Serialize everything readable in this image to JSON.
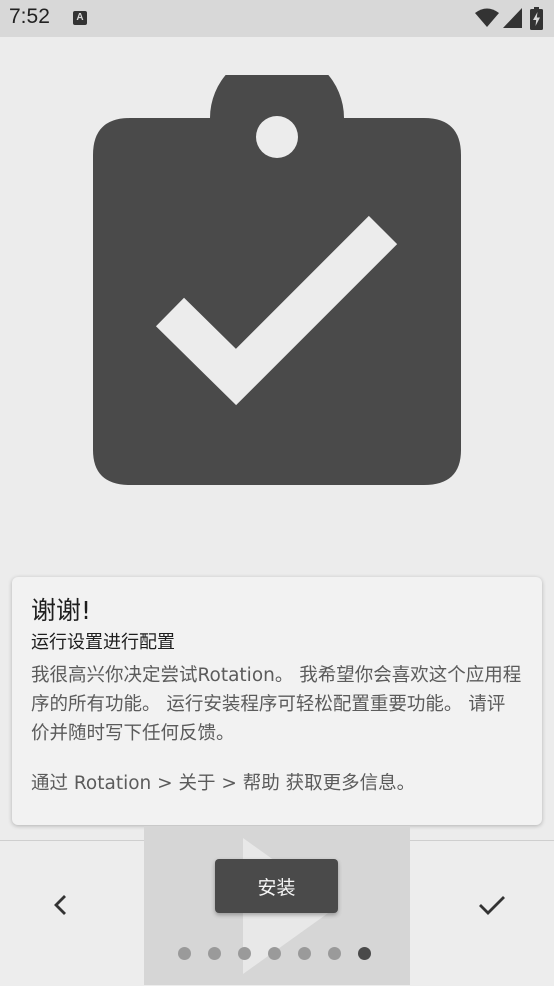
{
  "status_bar": {
    "time": "7:52",
    "notification_icon_letter": "A",
    "icons": [
      "wifi-icon",
      "signal-icon",
      "battery-charging-icon"
    ]
  },
  "hero": {
    "icon": "clipboard-check-icon",
    "color": "#4a4a4a"
  },
  "card": {
    "title": "谢谢!",
    "subtitle": "运行设置进行配置",
    "body": "我很高兴你决定尝试Rotation。 我希望你会喜欢这个应用程序的所有功能。 运行安装程序可轻松配置重要功能。 请评价并随时写下任何反馈。",
    "footer": "通过 Rotation > 关于 > 帮助 获取更多信息。"
  },
  "bottom": {
    "install_label": "安装",
    "back_icon": "chevron-left-icon",
    "done_icon": "check-icon",
    "page_count": 7,
    "current_page": 7
  },
  "colors": {
    "accent": "#4a4a4a",
    "background": "#ececec",
    "status_bar": "#d8d8d8"
  }
}
